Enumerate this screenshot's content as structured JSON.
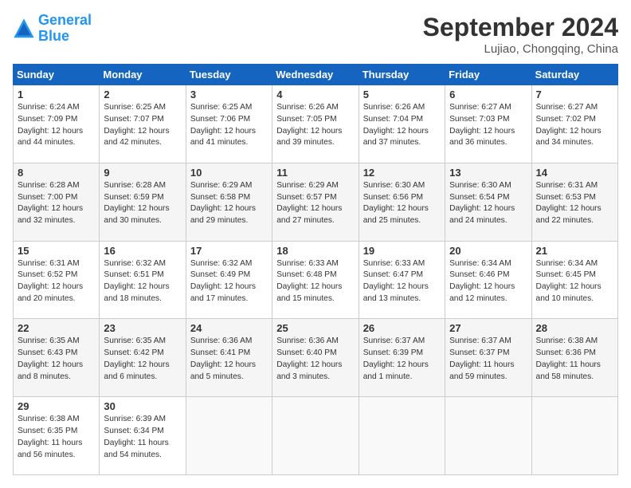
{
  "logo": {
    "line1": "General",
    "line2": "Blue"
  },
  "title": "September 2024",
  "location": "Lujiao, Chongqing, China",
  "days_header": [
    "Sunday",
    "Monday",
    "Tuesday",
    "Wednesday",
    "Thursday",
    "Friday",
    "Saturday"
  ],
  "weeks": [
    [
      {
        "day": "1",
        "sunrise": "Sunrise: 6:24 AM",
        "sunset": "Sunset: 7:09 PM",
        "daylight": "Daylight: 12 hours and 44 minutes."
      },
      {
        "day": "2",
        "sunrise": "Sunrise: 6:25 AM",
        "sunset": "Sunset: 7:07 PM",
        "daylight": "Daylight: 12 hours and 42 minutes."
      },
      {
        "day": "3",
        "sunrise": "Sunrise: 6:25 AM",
        "sunset": "Sunset: 7:06 PM",
        "daylight": "Daylight: 12 hours and 41 minutes."
      },
      {
        "day": "4",
        "sunrise": "Sunrise: 6:26 AM",
        "sunset": "Sunset: 7:05 PM",
        "daylight": "Daylight: 12 hours and 39 minutes."
      },
      {
        "day": "5",
        "sunrise": "Sunrise: 6:26 AM",
        "sunset": "Sunset: 7:04 PM",
        "daylight": "Daylight: 12 hours and 37 minutes."
      },
      {
        "day": "6",
        "sunrise": "Sunrise: 6:27 AM",
        "sunset": "Sunset: 7:03 PM",
        "daylight": "Daylight: 12 hours and 36 minutes."
      },
      {
        "day": "7",
        "sunrise": "Sunrise: 6:27 AM",
        "sunset": "Sunset: 7:02 PM",
        "daylight": "Daylight: 12 hours and 34 minutes."
      }
    ],
    [
      {
        "day": "8",
        "sunrise": "Sunrise: 6:28 AM",
        "sunset": "Sunset: 7:00 PM",
        "daylight": "Daylight: 12 hours and 32 minutes."
      },
      {
        "day": "9",
        "sunrise": "Sunrise: 6:28 AM",
        "sunset": "Sunset: 6:59 PM",
        "daylight": "Daylight: 12 hours and 30 minutes."
      },
      {
        "day": "10",
        "sunrise": "Sunrise: 6:29 AM",
        "sunset": "Sunset: 6:58 PM",
        "daylight": "Daylight: 12 hours and 29 minutes."
      },
      {
        "day": "11",
        "sunrise": "Sunrise: 6:29 AM",
        "sunset": "Sunset: 6:57 PM",
        "daylight": "Daylight: 12 hours and 27 minutes."
      },
      {
        "day": "12",
        "sunrise": "Sunrise: 6:30 AM",
        "sunset": "Sunset: 6:56 PM",
        "daylight": "Daylight: 12 hours and 25 minutes."
      },
      {
        "day": "13",
        "sunrise": "Sunrise: 6:30 AM",
        "sunset": "Sunset: 6:54 PM",
        "daylight": "Daylight: 12 hours and 24 minutes."
      },
      {
        "day": "14",
        "sunrise": "Sunrise: 6:31 AM",
        "sunset": "Sunset: 6:53 PM",
        "daylight": "Daylight: 12 hours and 22 minutes."
      }
    ],
    [
      {
        "day": "15",
        "sunrise": "Sunrise: 6:31 AM",
        "sunset": "Sunset: 6:52 PM",
        "daylight": "Daylight: 12 hours and 20 minutes."
      },
      {
        "day": "16",
        "sunrise": "Sunrise: 6:32 AM",
        "sunset": "Sunset: 6:51 PM",
        "daylight": "Daylight: 12 hours and 18 minutes."
      },
      {
        "day": "17",
        "sunrise": "Sunrise: 6:32 AM",
        "sunset": "Sunset: 6:49 PM",
        "daylight": "Daylight: 12 hours and 17 minutes."
      },
      {
        "day": "18",
        "sunrise": "Sunrise: 6:33 AM",
        "sunset": "Sunset: 6:48 PM",
        "daylight": "Daylight: 12 hours and 15 minutes."
      },
      {
        "day": "19",
        "sunrise": "Sunrise: 6:33 AM",
        "sunset": "Sunset: 6:47 PM",
        "daylight": "Daylight: 12 hours and 13 minutes."
      },
      {
        "day": "20",
        "sunrise": "Sunrise: 6:34 AM",
        "sunset": "Sunset: 6:46 PM",
        "daylight": "Daylight: 12 hours and 12 minutes."
      },
      {
        "day": "21",
        "sunrise": "Sunrise: 6:34 AM",
        "sunset": "Sunset: 6:45 PM",
        "daylight": "Daylight: 12 hours and 10 minutes."
      }
    ],
    [
      {
        "day": "22",
        "sunrise": "Sunrise: 6:35 AM",
        "sunset": "Sunset: 6:43 PM",
        "daylight": "Daylight: 12 hours and 8 minutes."
      },
      {
        "day": "23",
        "sunrise": "Sunrise: 6:35 AM",
        "sunset": "Sunset: 6:42 PM",
        "daylight": "Daylight: 12 hours and 6 minutes."
      },
      {
        "day": "24",
        "sunrise": "Sunrise: 6:36 AM",
        "sunset": "Sunset: 6:41 PM",
        "daylight": "Daylight: 12 hours and 5 minutes."
      },
      {
        "day": "25",
        "sunrise": "Sunrise: 6:36 AM",
        "sunset": "Sunset: 6:40 PM",
        "daylight": "Daylight: 12 hours and 3 minutes."
      },
      {
        "day": "26",
        "sunrise": "Sunrise: 6:37 AM",
        "sunset": "Sunset: 6:39 PM",
        "daylight": "Daylight: 12 hours and 1 minute."
      },
      {
        "day": "27",
        "sunrise": "Sunrise: 6:37 AM",
        "sunset": "Sunset: 6:37 PM",
        "daylight": "Daylight: 11 hours and 59 minutes."
      },
      {
        "day": "28",
        "sunrise": "Sunrise: 6:38 AM",
        "sunset": "Sunset: 6:36 PM",
        "daylight": "Daylight: 11 hours and 58 minutes."
      }
    ],
    [
      {
        "day": "29",
        "sunrise": "Sunrise: 6:38 AM",
        "sunset": "Sunset: 6:35 PM",
        "daylight": "Daylight: 11 hours and 56 minutes."
      },
      {
        "day": "30",
        "sunrise": "Sunrise: 6:39 AM",
        "sunset": "Sunset: 6:34 PM",
        "daylight": "Daylight: 11 hours and 54 minutes."
      },
      null,
      null,
      null,
      null,
      null
    ]
  ]
}
